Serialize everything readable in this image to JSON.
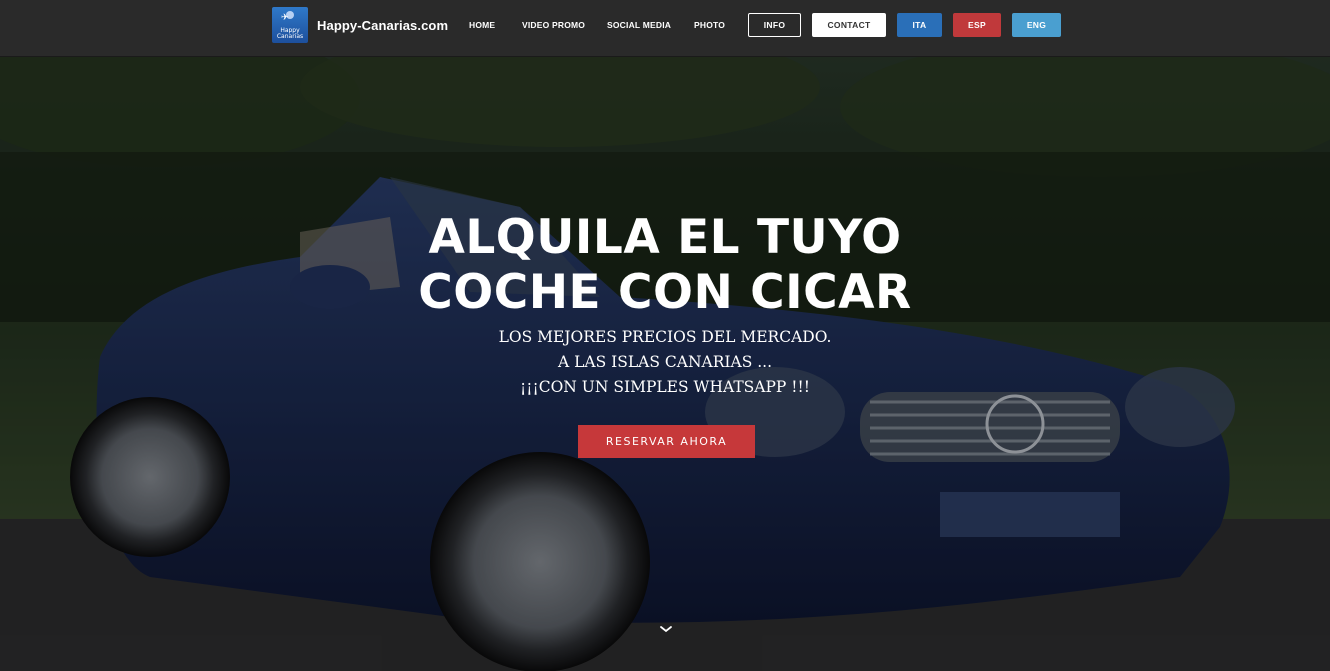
{
  "brand": {
    "name": "Happy-Canarias.com",
    "logo_text_1": "Happy",
    "logo_text_2": "Canarias"
  },
  "nav": {
    "links": [
      "HOME",
      "VIDEO PROMO",
      "SOCIAL MEDIA",
      "PHOTO"
    ],
    "info": "INFO",
    "contact": "CONTACT",
    "lang": [
      "ITA",
      "ESP",
      "ENG"
    ]
  },
  "hero": {
    "title_line1": "ALQUILA EL TUYO",
    "title_line2": "COCHE CON CICAR",
    "subtitle_line1": "LOS MEJORES PRECIOS DEL MERCADO.",
    "subtitle_line2": "A LAS ISLAS CANARIAS ...",
    "subtitle_line3": "¡¡¡CON UN SIMPLES WHATSAPP !!!",
    "cta": "RESERVAR AHORA"
  },
  "icons": {
    "scroll": "chevron-down-icon",
    "logo": "bird-icon"
  },
  "colors": {
    "navbar": "#2a2a2a",
    "cta": "#c6383a",
    "ita": "#2a6fb8",
    "esp": "#c0393b",
    "eng": "#4a9fd0"
  }
}
